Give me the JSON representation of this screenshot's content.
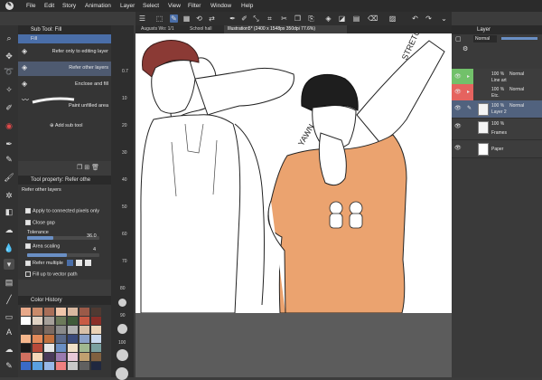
{
  "menu": [
    "File",
    "Edit",
    "Story",
    "Animation",
    "Layer",
    "Select",
    "View",
    "Filter",
    "Window",
    "Help"
  ],
  "subtool": {
    "title": "Sub Tool: Fill",
    "items": [
      {
        "label": "Fill",
        "group": true
      },
      {
        "label": "Refer only to editing layer"
      },
      {
        "label": "Refer other layers",
        "selected": true
      },
      {
        "label": "Enclose and fill"
      },
      {
        "label": "Paint unfilled area"
      }
    ],
    "add_label": "Add sub tool"
  },
  "toolprop": {
    "title": "Tool property: Refer othe",
    "subtitle": "Refer other layers",
    "apply_connected": "Apply to connected pixels only",
    "close_gap": "Close gap",
    "tolerance_label": "Tolerance",
    "tolerance_value": "36.0",
    "tolerance_fraction": 0.36,
    "area_scaling": "Area scaling",
    "area_scaling_value": "4",
    "area_fraction": 0.55,
    "refer_multiple": "Refer multiple",
    "fill_vector": "Fill up to vector path"
  },
  "color_history": {
    "title": "Color History",
    "colors": [
      "#e8a98a",
      "#c98a6a",
      "#a86e58",
      "#f0c6aa",
      "#d9b8a0",
      "#9b5a48",
      "#4f3a32",
      "#ffffff",
      "#e0d2c4",
      "#a6a09a",
      "#6c7a5a",
      "#3f5a3a",
      "#c85a44",
      "#8a2e28",
      "#2f2f2f",
      "#5a4a44",
      "#7a6a62",
      "#8a8a8a",
      "#b0b0b0",
      "#d8c0a8",
      "#ebd2b6",
      "#f4b68c",
      "#e38a5a",
      "#c0703e",
      "#5a6a8a",
      "#3a4a7a",
      "#8aa0c8",
      "#c8d8ee",
      "#1a1a1a",
      "#b84a3a",
      "#e6e6e6",
      "#6a8fc4",
      "#f0e0c8",
      "#a0b890",
      "#7aa0a0",
      "#d07060",
      "#f3d7b9",
      "#4a3a5a",
      "#9a7ab0",
      "#e8c8d8",
      "#c0a070",
      "#806040",
      "#3a6ac8",
      "#5aa0e0",
      "#98b8e8",
      "#f08080",
      "#c8c8c8",
      "#606060",
      "#202840"
    ]
  },
  "tabs": [
    {
      "label": "Augusts Wo: 1/1",
      "active": false
    },
    {
      "label": "School hall",
      "active": false
    },
    {
      "label": "Illustration5* (2400 x 1548px 350dpi 77.6%)",
      "active": true
    }
  ],
  "canvas": {
    "text1": "STRETCH",
    "text2": "YAWN"
  },
  "layers": {
    "title": "Layer",
    "blend_mode": "Normal",
    "rows": [
      {
        "opacity": "100 %",
        "mode": "Normal",
        "name": "Line art",
        "color": "green",
        "folder": true
      },
      {
        "opacity": "100 %",
        "mode": "Normal",
        "name": "Etc.",
        "color": "red",
        "folder": true
      },
      {
        "opacity": "100 %",
        "mode": "Normal",
        "name": "Layer 2",
        "selected": true
      },
      {
        "opacity": "100 %",
        "mode": "",
        "name": "Frames"
      },
      {
        "opacity": "",
        "mode": "",
        "name": "Paper"
      }
    ]
  },
  "ruler_numbers": [
    "0.7",
    "10",
    "20",
    "30",
    "40",
    "50",
    "60",
    "70",
    "80",
    "90",
    "100"
  ]
}
